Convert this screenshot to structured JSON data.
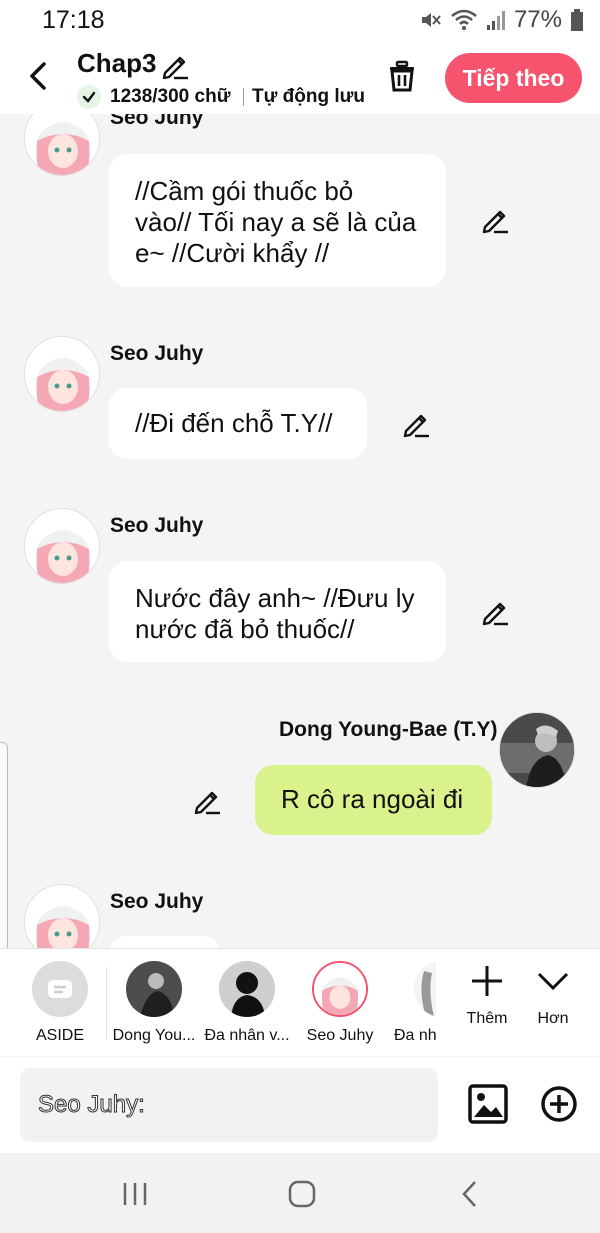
{
  "status": {
    "time": "17:18",
    "battery": "77%"
  },
  "header": {
    "title": "Chap3",
    "word_count": "1238/300 chữ",
    "autosave": "Tự động lưu",
    "next_label": "Tiếp theo"
  },
  "messages": [
    {
      "speaker": "Seo Juhy",
      "text_lines": [
        "//Cầm gói thuốc bỏ",
        "vào// Tối nay a sẽ là của",
        "e~ //Cười khẩy //"
      ]
    },
    {
      "speaker": "Seo Juhy",
      "text_lines": [
        "//Đi đến chỗ T.Y//"
      ]
    },
    {
      "speaker": "Seo Juhy",
      "text_lines": [
        "Nước đây anh~ //Đưu ly",
        "nước đã bỏ thuốc//"
      ]
    },
    {
      "speaker": "Dong Young-Bae (T.Y)",
      "text_lines": [
        "R cô ra ngoài đi"
      ]
    },
    {
      "speaker": "Seo Juhy",
      "text_lines": []
    }
  ],
  "characters": [
    {
      "label": "ASIDE"
    },
    {
      "label": "Dong You..."
    },
    {
      "label": "Đa nhân v..."
    },
    {
      "label": "Seo Juhy"
    },
    {
      "label": "Đa nhâ"
    }
  ],
  "tools": {
    "add_label": "Thêm",
    "more_label": "Hơn"
  },
  "input": {
    "placeholder": "Seo Juhy:"
  },
  "icons": [
    "back-icon",
    "pencil-icon",
    "check-icon",
    "trash-icon",
    "image-icon",
    "add-circle-icon",
    "recents-icon",
    "home-icon",
    "nav-back-icon"
  ],
  "colors": {
    "accent": "#f5536e",
    "bubble_right": "#d9f28c",
    "bubble_left": "#ffffff"
  }
}
